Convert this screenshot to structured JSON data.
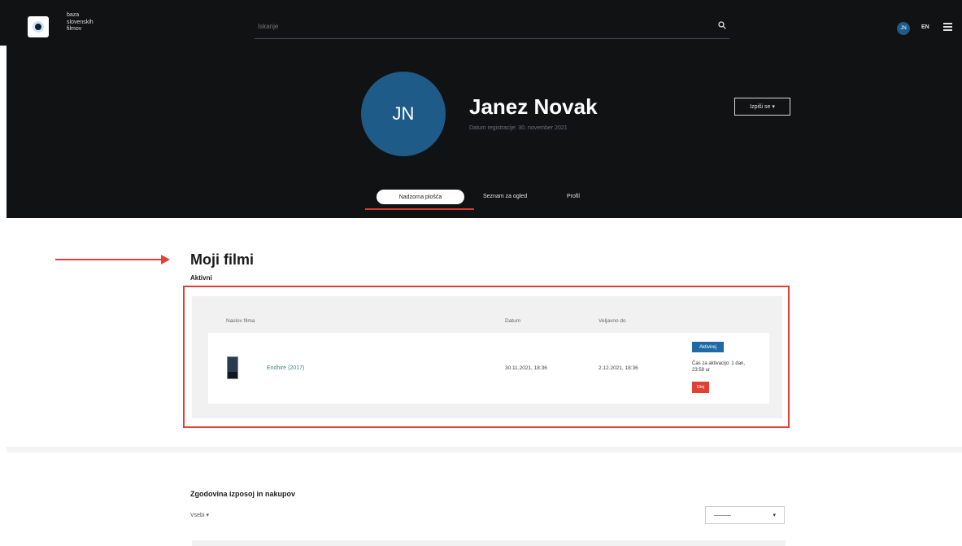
{
  "header": {
    "logo_lines": [
      "baza",
      "slovenskih",
      "filmov"
    ],
    "search_placeholder": "Iskanje",
    "user_initials": "JN",
    "language": "EN"
  },
  "profile": {
    "initials": "JN",
    "name": "Janez Novak",
    "registration": "Datum registracije: 30. november 2021",
    "logout_label": "Izpiši se  ▾",
    "tabs": [
      {
        "label": "Nadzorna plošča",
        "active": true
      },
      {
        "label": "Seznam za ogled",
        "active": false
      },
      {
        "label": "Profil",
        "active": false
      }
    ]
  },
  "my_films": {
    "title": "Moji filmi",
    "subtitle": "Aktivni",
    "columns": [
      "Naslov filma",
      "Datum",
      "Veljavno do"
    ],
    "rows": [
      {
        "title": "Endhire (2017)",
        "date": "30.11.2021, 18:36",
        "valid_until": "2.12.2021, 18:36",
        "status": "Aktivirej",
        "time_left": "Čas za aktivacijo: 1 dan, 23:59 ur",
        "watch_label": "Glej"
      }
    ]
  },
  "history": {
    "title": "Zgodovina izposoj in nakupov",
    "show_label": "Vsebi  ▾",
    "select_value": "———",
    "select_chevron": "▾"
  },
  "colors": {
    "accent": "#e24035",
    "primary": "#1f6aa5",
    "dark_bg": "#111214"
  }
}
